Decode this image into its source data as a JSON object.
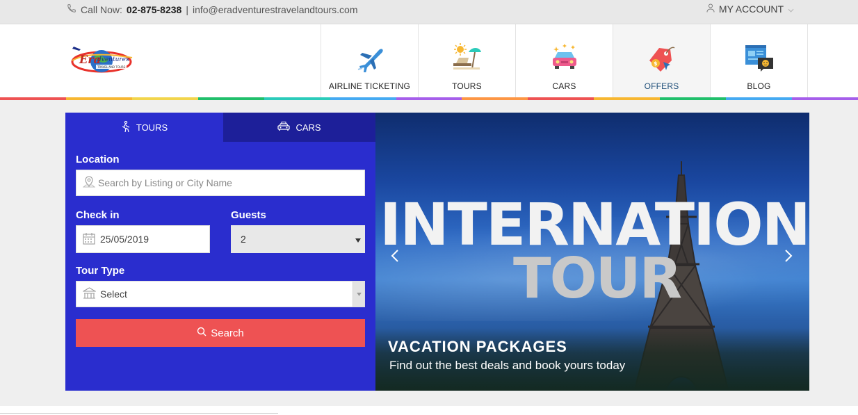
{
  "topbar": {
    "call_label": "Call Now:",
    "phone": "02-875-8238",
    "separator": "|",
    "email": "info@eradventurestravelandtours.com",
    "account_label": "MY ACCOUNT"
  },
  "nav": {
    "items": [
      {
        "label": "AIRLINE TICKETING",
        "icon": "airplane-icon"
      },
      {
        "label": "TOURS",
        "icon": "beach-icon"
      },
      {
        "label": "CARS",
        "icon": "car-icon"
      },
      {
        "label": "OFFERS",
        "icon": "offers-tag-icon",
        "active": true
      },
      {
        "label": "BLOG",
        "icon": "blog-icon"
      }
    ]
  },
  "search": {
    "tabs": [
      {
        "label": "TOURS",
        "icon": "hiker-icon",
        "active": true
      },
      {
        "label": "CARS",
        "icon": "taxi-icon"
      }
    ],
    "location_label": "Location",
    "location_placeholder": "Search by Listing or City Name",
    "checkin_label": "Check in",
    "checkin_value": "25/05/2019",
    "guests_label": "Guests",
    "guests_value": "2",
    "tour_type_label": "Tour Type",
    "tour_type_value": "Select",
    "search_button": "Search"
  },
  "slider": {
    "headline_1": "INTERNATIONAL",
    "headline_2": "TOUR",
    "caption_title": "VACATION PACKAGES",
    "caption_subtitle": "Find out the best deals and book yours today"
  },
  "colors": {
    "panel": "#2a2dce",
    "panel_tab_inactive": "#1d1f99",
    "search_button": "#ee5253",
    "rainbow": [
      "#ee5253",
      "#f7b731",
      "#f2d54c",
      "#20bf6b",
      "#2bcbba",
      "#45aaf2",
      "#a55eea",
      "#fd9644",
      "#ee5253",
      "#f7b731",
      "#20bf6b",
      "#45aaf2",
      "#a55eea"
    ]
  }
}
